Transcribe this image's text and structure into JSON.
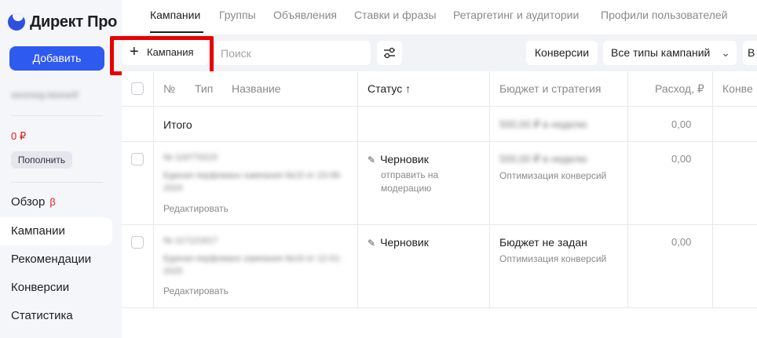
{
  "sidebar": {
    "logo_text": "Директ Про",
    "add_button": "Добавить",
    "user_name": "seomeg-lasearif",
    "balance": "0 ₽",
    "topup_button": "Пополнить",
    "nav": [
      {
        "label": "Обзор",
        "badge": "β"
      },
      {
        "label": "Кампании"
      },
      {
        "label": "Рекомендации"
      },
      {
        "label": "Конверсии"
      },
      {
        "label": "Статистика"
      }
    ]
  },
  "tabs": [
    "Кампании",
    "Группы",
    "Объявления",
    "Ставки и фразы",
    "Ретаргетинг и аудитории",
    "Профили пользователей"
  ],
  "toolbar": {
    "campaign_button": "Кампания",
    "search_placeholder": "Поиск",
    "conversions_button": "Конверсии",
    "types_select": "Все типы кампаний",
    "more_button": "В"
  },
  "table": {
    "headers": {
      "num": "№",
      "type": "Тип",
      "name": "Название",
      "status": "Статус ↑",
      "budget": "Бюджет и стратегия",
      "spend": "Расход, ₽",
      "conv": "Конве"
    },
    "total": {
      "label": "Итого",
      "budget": "500,00 ₽ в неделю",
      "spend": "0,00"
    },
    "rows": [
      {
        "id": "№ 116770215",
        "name": "Единая перфоманс кампания №15 от 23-08-2024",
        "edit": "Редактировать",
        "status": "Черновик",
        "status_note_1": "отправить на",
        "status_note_2": "модерацию",
        "budget": "500,00 ₽ в неделю",
        "strategy": "Оптимизация конверсий",
        "spend": "0,00"
      },
      {
        "id": "№ 117121617",
        "name": "Единая перфоманс кампания №16 от 12-01-2025",
        "edit": "Редактировать",
        "status": "Черновик",
        "budget": "Бюджет не задан",
        "strategy": "Оптимизация конверсий",
        "spend": "0,00"
      }
    ]
  },
  "colors": {
    "accent": "#2f5af0",
    "highlight": "#e80000",
    "balance": "#e01b1b",
    "sidebar_bg": "#f5f6fa"
  }
}
